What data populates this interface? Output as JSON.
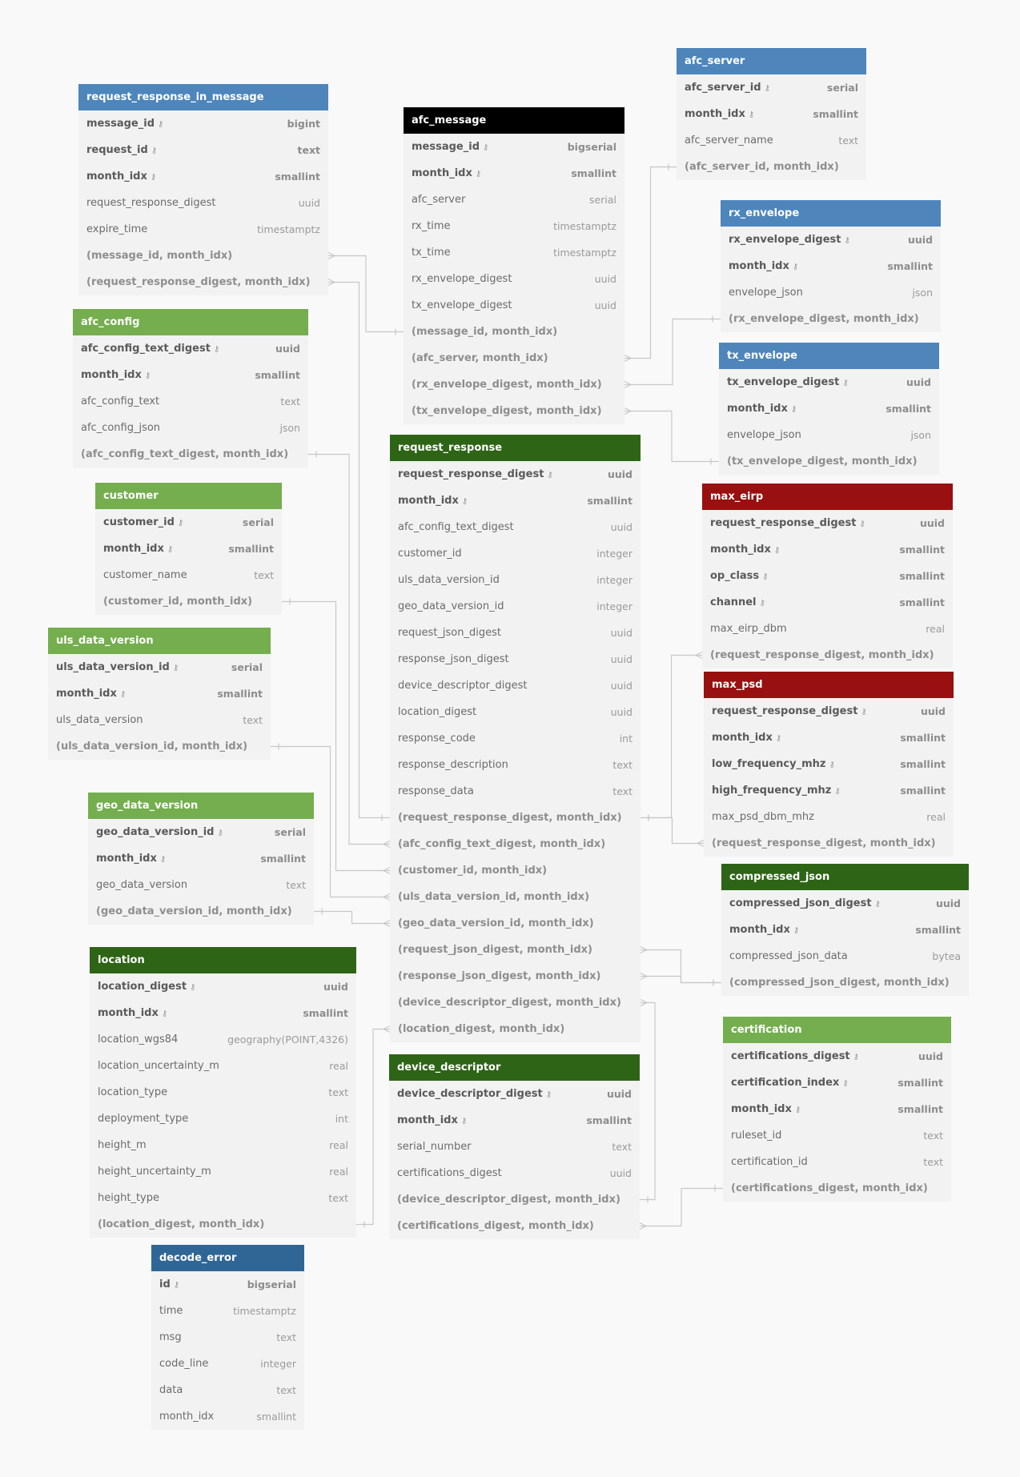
{
  "colors": {
    "blue": "#4e86bb",
    "dark_blue": "#2f6696",
    "black": "#000000",
    "light_green": "#74ae4e",
    "dark_green": "#2e6416",
    "red": "#98100f",
    "link": "#c8c8c8"
  },
  "key_icon": "key-icon",
  "tables": [
    {
      "id": "request_response_in_message",
      "title": "request_response_in_message",
      "color": "blue",
      "rows": [
        {
          "name": "message_id",
          "type": "bigint",
          "kind": "pk"
        },
        {
          "name": "request_id",
          "type": "text",
          "kind": "pk"
        },
        {
          "name": "month_idx",
          "type": "smallint",
          "kind": "pk"
        },
        {
          "name": "request_response_digest",
          "type": "uuid",
          "kind": "col"
        },
        {
          "name": "expire_time",
          "type": "timestamptz",
          "kind": "col"
        },
        {
          "name": "(message_id, month_idx)",
          "type": "",
          "kind": "idx"
        },
        {
          "name": "(request_response_digest, month_idx)",
          "type": "",
          "kind": "idx"
        }
      ]
    },
    {
      "id": "afc_message",
      "title": "afc_message",
      "color": "black",
      "rows": [
        {
          "name": "message_id",
          "type": "bigserial",
          "kind": "pk"
        },
        {
          "name": "month_idx",
          "type": "smallint",
          "kind": "pk"
        },
        {
          "name": "afc_server",
          "type": "serial",
          "kind": "col"
        },
        {
          "name": "rx_time",
          "type": "timestamptz",
          "kind": "col"
        },
        {
          "name": "tx_time",
          "type": "timestamptz",
          "kind": "col"
        },
        {
          "name": "rx_envelope_digest",
          "type": "uuid",
          "kind": "col"
        },
        {
          "name": "tx_envelope_digest",
          "type": "uuid",
          "kind": "col"
        },
        {
          "name": "(message_id, month_idx)",
          "type": "",
          "kind": "idx"
        },
        {
          "name": "(afc_server, month_idx)",
          "type": "",
          "kind": "idx"
        },
        {
          "name": "(rx_envelope_digest, month_idx)",
          "type": "",
          "kind": "idx"
        },
        {
          "name": "(tx_envelope_digest, month_idx)",
          "type": "",
          "kind": "idx"
        }
      ]
    },
    {
      "id": "afc_server",
      "title": "afc_server",
      "color": "blue",
      "rows": [
        {
          "name": "afc_server_id",
          "type": "serial",
          "kind": "pk"
        },
        {
          "name": "month_idx",
          "type": "smallint",
          "kind": "pk"
        },
        {
          "name": "afc_server_name",
          "type": "text",
          "kind": "col"
        },
        {
          "name": "(afc_server_id, month_idx)",
          "type": "",
          "kind": "idx"
        }
      ]
    },
    {
      "id": "rx_envelope",
      "title": "rx_envelope",
      "color": "blue",
      "rows": [
        {
          "name": "rx_envelope_digest",
          "type": "uuid",
          "kind": "pk"
        },
        {
          "name": "month_idx",
          "type": "smallint",
          "kind": "pk"
        },
        {
          "name": "envelope_json",
          "type": "json",
          "kind": "col"
        },
        {
          "name": "(rx_envelope_digest, month_idx)",
          "type": "",
          "kind": "idx"
        }
      ]
    },
    {
      "id": "tx_envelope",
      "title": "tx_envelope",
      "color": "blue",
      "rows": [
        {
          "name": "tx_envelope_digest",
          "type": "uuid",
          "kind": "pk"
        },
        {
          "name": "month_idx",
          "type": "smallint",
          "kind": "pk"
        },
        {
          "name": "envelope_json",
          "type": "json",
          "kind": "col"
        },
        {
          "name": "(tx_envelope_digest, month_idx)",
          "type": "",
          "kind": "idx"
        }
      ]
    },
    {
      "id": "afc_config",
      "title": "afc_config",
      "color": "light_green",
      "rows": [
        {
          "name": "afc_config_text_digest",
          "type": "uuid",
          "kind": "pk"
        },
        {
          "name": "month_idx",
          "type": "smallint",
          "kind": "pk"
        },
        {
          "name": "afc_config_text",
          "type": "text",
          "kind": "col"
        },
        {
          "name": "afc_config_json",
          "type": "json",
          "kind": "col"
        },
        {
          "name": "(afc_config_text_digest, month_idx)",
          "type": "",
          "kind": "idx"
        }
      ]
    },
    {
      "id": "customer",
      "title": "customer",
      "color": "light_green",
      "rows": [
        {
          "name": "customer_id",
          "type": "serial",
          "kind": "pk"
        },
        {
          "name": "month_idx",
          "type": "smallint",
          "kind": "pk"
        },
        {
          "name": "customer_name",
          "type": "text",
          "kind": "col"
        },
        {
          "name": "(customer_id, month_idx)",
          "type": "",
          "kind": "idx"
        }
      ]
    },
    {
      "id": "uls_data_version",
      "title": "uls_data_version",
      "color": "light_green",
      "rows": [
        {
          "name": "uls_data_version_id",
          "type": "serial",
          "kind": "pk"
        },
        {
          "name": "month_idx",
          "type": "smallint",
          "kind": "pk"
        },
        {
          "name": "uls_data_version",
          "type": "text",
          "kind": "col"
        },
        {
          "name": "(uls_data_version_id, month_idx)",
          "type": "",
          "kind": "idx"
        }
      ]
    },
    {
      "id": "geo_data_version",
      "title": "geo_data_version",
      "color": "light_green",
      "rows": [
        {
          "name": "geo_data_version_id",
          "type": "serial",
          "kind": "pk"
        },
        {
          "name": "month_idx",
          "type": "smallint",
          "kind": "pk"
        },
        {
          "name": "geo_data_version",
          "type": "text",
          "kind": "col"
        },
        {
          "name": "(geo_data_version_id, month_idx)",
          "type": "",
          "kind": "idx"
        }
      ]
    },
    {
      "id": "location",
      "title": "location",
      "color": "dark_green",
      "rows": [
        {
          "name": "location_digest",
          "type": "uuid",
          "kind": "pk"
        },
        {
          "name": "month_idx",
          "type": "smallint",
          "kind": "pk"
        },
        {
          "name": "location_wgs84",
          "type": "geography(POINT,4326)",
          "kind": "col"
        },
        {
          "name": "location_uncertainty_m",
          "type": "real",
          "kind": "col"
        },
        {
          "name": "location_type",
          "type": "text",
          "kind": "col"
        },
        {
          "name": "deployment_type",
          "type": "int",
          "kind": "col"
        },
        {
          "name": "height_m",
          "type": "real",
          "kind": "col"
        },
        {
          "name": "height_uncertainty_m",
          "type": "real",
          "kind": "col"
        },
        {
          "name": "height_type",
          "type": "text",
          "kind": "col"
        },
        {
          "name": "(location_digest, month_idx)",
          "type": "",
          "kind": "idx"
        }
      ]
    },
    {
      "id": "decode_error",
      "title": "decode_error",
      "color": "dark_blue",
      "rows": [
        {
          "name": "id",
          "type": "bigserial",
          "kind": "pk"
        },
        {
          "name": "time",
          "type": "timestamptz",
          "kind": "col"
        },
        {
          "name": "msg",
          "type": "text",
          "kind": "col"
        },
        {
          "name": "code_line",
          "type": "integer",
          "kind": "col"
        },
        {
          "name": "data",
          "type": "text",
          "kind": "col"
        },
        {
          "name": "month_idx",
          "type": "smallint",
          "kind": "col"
        }
      ]
    },
    {
      "id": "request_response",
      "title": "request_response",
      "color": "dark_green",
      "rows": [
        {
          "name": "request_response_digest",
          "type": "uuid",
          "kind": "pk"
        },
        {
          "name": "month_idx",
          "type": "smallint",
          "kind": "pk"
        },
        {
          "name": "afc_config_text_digest",
          "type": "uuid",
          "kind": "col"
        },
        {
          "name": "customer_id",
          "type": "integer",
          "kind": "col"
        },
        {
          "name": "uls_data_version_id",
          "type": "integer",
          "kind": "col"
        },
        {
          "name": "geo_data_version_id",
          "type": "integer",
          "kind": "col"
        },
        {
          "name": "request_json_digest",
          "type": "uuid",
          "kind": "col"
        },
        {
          "name": "response_json_digest",
          "type": "uuid",
          "kind": "col"
        },
        {
          "name": "device_descriptor_digest",
          "type": "uuid",
          "kind": "col"
        },
        {
          "name": "location_digest",
          "type": "uuid",
          "kind": "col"
        },
        {
          "name": "response_code",
          "type": "int",
          "kind": "col"
        },
        {
          "name": "response_description",
          "type": "text",
          "kind": "col"
        },
        {
          "name": "response_data",
          "type": "text",
          "kind": "col"
        },
        {
          "name": "(request_response_digest, month_idx)",
          "type": "",
          "kind": "idx"
        },
        {
          "name": "(afc_config_text_digest, month_idx)",
          "type": "",
          "kind": "idx"
        },
        {
          "name": "(customer_id, month_idx)",
          "type": "",
          "kind": "idx"
        },
        {
          "name": "(uls_data_version_id, month_idx)",
          "type": "",
          "kind": "idx"
        },
        {
          "name": "(geo_data_version_id, month_idx)",
          "type": "",
          "kind": "idx"
        },
        {
          "name": "(request_json_digest, month_idx)",
          "type": "",
          "kind": "idx"
        },
        {
          "name": "(response_json_digest, month_idx)",
          "type": "",
          "kind": "idx"
        },
        {
          "name": "(device_descriptor_digest, month_idx)",
          "type": "",
          "kind": "idx"
        },
        {
          "name": "(location_digest, month_idx)",
          "type": "",
          "kind": "idx"
        }
      ]
    },
    {
      "id": "device_descriptor",
      "title": "device_descriptor",
      "color": "dark_green",
      "rows": [
        {
          "name": "device_descriptor_digest",
          "type": "uuid",
          "kind": "pk"
        },
        {
          "name": "month_idx",
          "type": "smallint",
          "kind": "pk"
        },
        {
          "name": "serial_number",
          "type": "text",
          "kind": "col"
        },
        {
          "name": "certifications_digest",
          "type": "uuid",
          "kind": "col"
        },
        {
          "name": "(device_descriptor_digest, month_idx)",
          "type": "",
          "kind": "idx"
        },
        {
          "name": "(certifications_digest, month_idx)",
          "type": "",
          "kind": "idx"
        }
      ]
    },
    {
      "id": "max_eirp",
      "title": "max_eirp",
      "color": "red",
      "rows": [
        {
          "name": "request_response_digest",
          "type": "uuid",
          "kind": "pk"
        },
        {
          "name": "month_idx",
          "type": "smallint",
          "kind": "pk"
        },
        {
          "name": "op_class",
          "type": "smallint",
          "kind": "pk"
        },
        {
          "name": "channel",
          "type": "smallint",
          "kind": "pk"
        },
        {
          "name": "max_eirp_dbm",
          "type": "real",
          "kind": "col"
        },
        {
          "name": "(request_response_digest, month_idx)",
          "type": "",
          "kind": "idx"
        }
      ]
    },
    {
      "id": "max_psd",
      "title": "max_psd",
      "color": "red",
      "rows": [
        {
          "name": "request_response_digest",
          "type": "uuid",
          "kind": "pk"
        },
        {
          "name": "month_idx",
          "type": "smallint",
          "kind": "pk"
        },
        {
          "name": "low_frequency_mhz",
          "type": "smallint",
          "kind": "pk"
        },
        {
          "name": "high_frequency_mhz",
          "type": "smallint",
          "kind": "pk"
        },
        {
          "name": "max_psd_dbm_mhz",
          "type": "real",
          "kind": "col"
        },
        {
          "name": "(request_response_digest, month_idx)",
          "type": "",
          "kind": "idx"
        }
      ]
    },
    {
      "id": "compressed_json",
      "title": "compressed_json",
      "color": "dark_green",
      "rows": [
        {
          "name": "compressed_json_digest",
          "type": "uuid",
          "kind": "pk"
        },
        {
          "name": "month_idx",
          "type": "smallint",
          "kind": "pk"
        },
        {
          "name": "compressed_json_data",
          "type": "bytea",
          "kind": "col"
        },
        {
          "name": "(compressed_json_digest, month_idx)",
          "type": "",
          "kind": "idx"
        }
      ]
    },
    {
      "id": "certification",
      "title": "certification",
      "color": "light_green",
      "rows": [
        {
          "name": "certifications_digest",
          "type": "uuid",
          "kind": "pk"
        },
        {
          "name": "certification_index",
          "type": "smallint",
          "kind": "pk"
        },
        {
          "name": "month_idx",
          "type": "smallint",
          "kind": "pk"
        },
        {
          "name": "ruleset_id",
          "type": "text",
          "kind": "col"
        },
        {
          "name": "certification_id",
          "type": "text",
          "kind": "col"
        },
        {
          "name": "(certifications_digest, month_idx)",
          "type": "",
          "kind": "idx"
        }
      ]
    }
  ],
  "relations": [
    {
      "from": "request_response_in_message",
      "from_row": 5,
      "to": "afc_message",
      "to_row": 7
    },
    {
      "from": "request_response_in_message",
      "from_row": 6,
      "to": "request_response",
      "to_row": 13
    },
    {
      "from": "afc_message",
      "from_row": 8,
      "to": "afc_server",
      "to_row": 3
    },
    {
      "from": "afc_message",
      "from_row": 9,
      "to": "rx_envelope",
      "to_row": 3
    },
    {
      "from": "afc_message",
      "from_row": 10,
      "to": "tx_envelope",
      "to_row": 3
    },
    {
      "from": "request_response",
      "from_row": 14,
      "to": "afc_config",
      "to_row": 4
    },
    {
      "from": "request_response",
      "from_row": 15,
      "to": "customer",
      "to_row": 3
    },
    {
      "from": "request_response",
      "from_row": 16,
      "to": "uls_data_version",
      "to_row": 3
    },
    {
      "from": "request_response",
      "from_row": 17,
      "to": "geo_data_version",
      "to_row": 3
    },
    {
      "from": "max_eirp",
      "from_row": 5,
      "to": "request_response",
      "to_row": 13
    },
    {
      "from": "max_psd",
      "from_row": 5,
      "to": "request_response",
      "to_row": 13
    },
    {
      "from": "request_response",
      "from_row": 18,
      "to": "compressed_json",
      "to_row": 3
    },
    {
      "from": "request_response",
      "from_row": 19,
      "to": "compressed_json",
      "to_row": 3
    },
    {
      "from": "request_response",
      "from_row": 20,
      "to": "device_descriptor",
      "to_row": 4
    },
    {
      "from": "request_response",
      "from_row": 21,
      "to": "location",
      "to_row": 9
    },
    {
      "from": "device_descriptor",
      "from_row": 5,
      "to": "certification",
      "to_row": 5
    }
  ]
}
